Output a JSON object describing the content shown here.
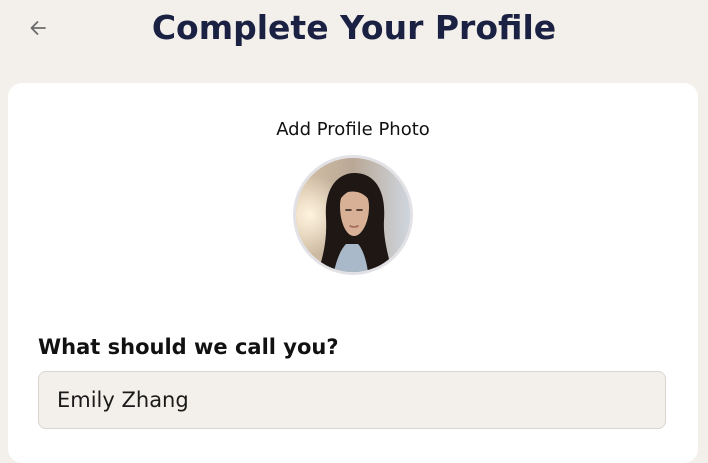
{
  "header": {
    "title": "Complete Your Profile",
    "back_icon": "arrow-left-icon"
  },
  "profile_photo": {
    "label": "Add Profile Photo"
  },
  "name_field": {
    "label": "What should we call you?",
    "value": "Emily Zhang"
  },
  "colors": {
    "background": "#f3f0eb",
    "card": "#ffffff",
    "title": "#1a2142",
    "input_background": "#f3f0eb"
  }
}
